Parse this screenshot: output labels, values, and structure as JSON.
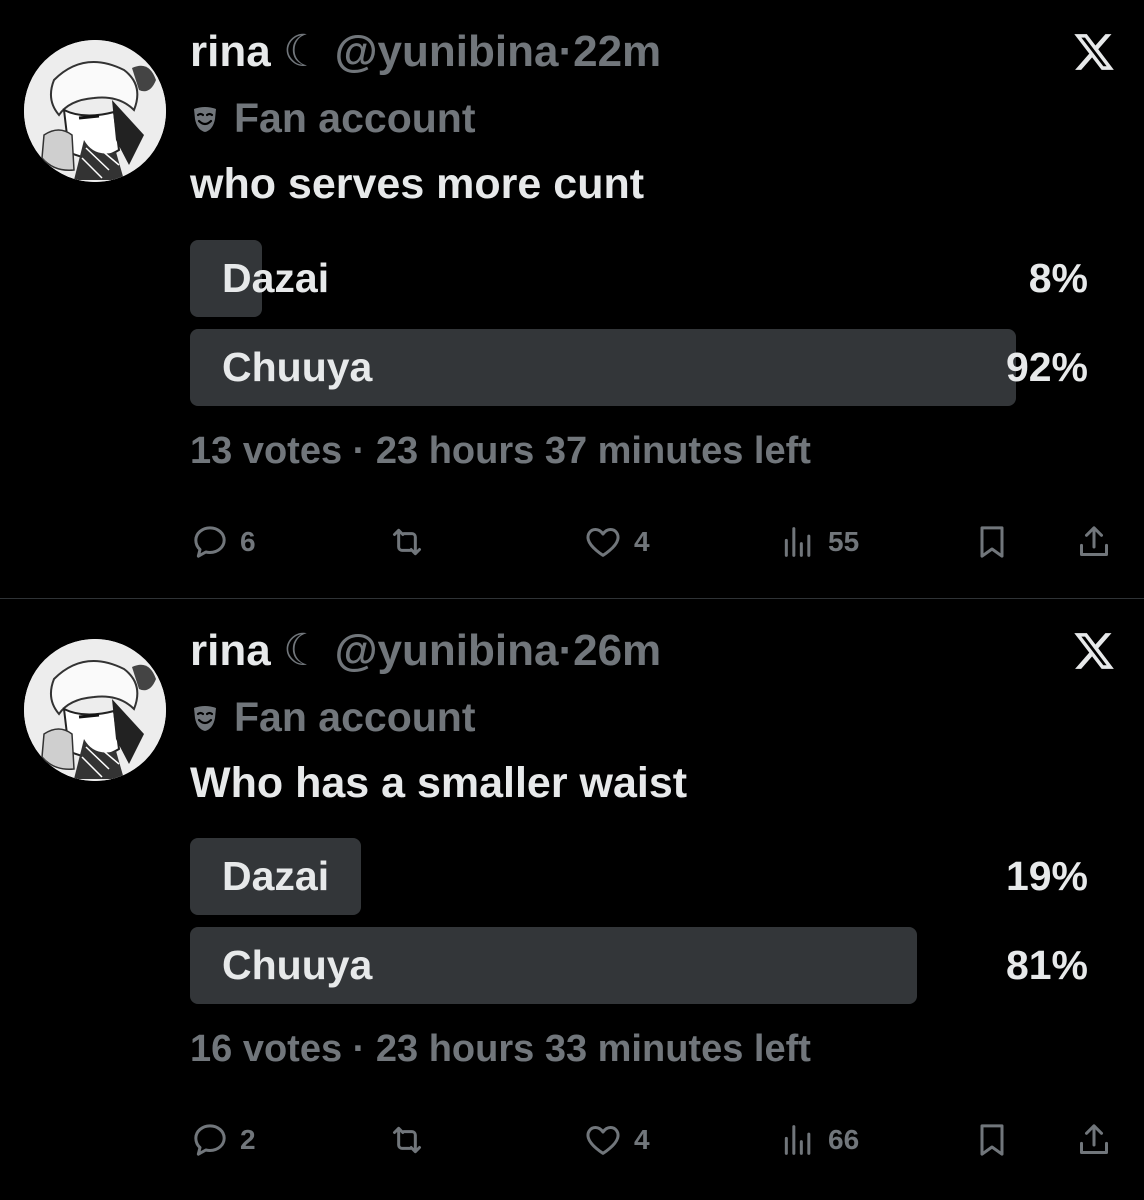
{
  "tweets": [
    {
      "name": "rina",
      "name_symbol": "☾",
      "handle": "@yunibina",
      "separator": "·",
      "time": "22m",
      "label_icon": "theater-mask-icon",
      "label": "Fan account",
      "text": "who serves more cunt",
      "poll": {
        "options": [
          {
            "label": "Dazai",
            "percent_text": "8%",
            "percent": 8
          },
          {
            "label": "Chuuya",
            "percent_text": "92%",
            "percent": 92
          }
        ],
        "votes": "13 votes",
        "time_left": "23 hours 37 minutes left"
      },
      "actions": {
        "replies": "6",
        "reposts": "",
        "likes": "4",
        "views": "55"
      }
    },
    {
      "name": "rina",
      "name_symbol": "☾",
      "handle": "@yunibina",
      "separator": "·",
      "time": "26m",
      "label_icon": "theater-mask-icon",
      "label": "Fan account",
      "text": "Who has a smaller waist",
      "poll": {
        "options": [
          {
            "label": "Dazai",
            "percent_text": "19%",
            "percent": 19
          },
          {
            "label": "Chuuya",
            "percent_text": "81%",
            "percent": 81
          }
        ],
        "votes": "16 votes",
        "time_left": "23 hours 33 minutes left"
      },
      "actions": {
        "replies": "2",
        "reposts": "",
        "likes": "4",
        "views": "66"
      }
    }
  ],
  "colors": {
    "background": "#000000",
    "text_primary": "#e7e9ea",
    "text_secondary": "#71767b",
    "poll_bar": "#333639",
    "divider": "#2f3336"
  }
}
